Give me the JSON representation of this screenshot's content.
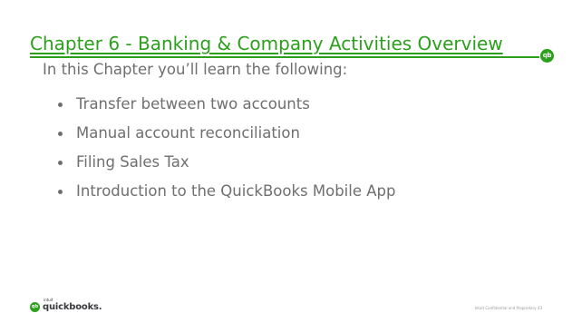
{
  "slide": {
    "title": "Chapter 6 - Banking & Company Activities Overview",
    "intro": "In this Chapter you’ll learn the following:",
    "bullets": [
      "Transfer between two accounts",
      "Manual account reconciliation",
      "Filing Sales Tax",
      "Introduction to the QuickBooks Mobile App"
    ]
  },
  "branding": {
    "title_logo_text": "qb",
    "footer_logo_mark": "qb",
    "footer_logo_small": "intuit",
    "footer_logo_name": "quickbooks."
  },
  "footer": {
    "note": "Intuit Confidential and Proprietary    43"
  },
  "icons": {
    "title_logo": "quickbooks-logo-icon",
    "footer_logo": "quickbooks-logo-icon"
  },
  "colors": {
    "accent": "#2ca01c",
    "body_text": "#6f6f6f",
    "brand_text": "#393a3d"
  }
}
